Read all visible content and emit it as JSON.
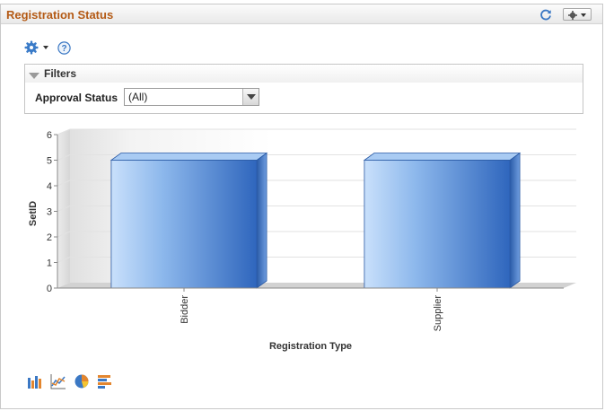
{
  "pagelet": {
    "title": "Registration Status"
  },
  "filters": {
    "title": "Filters",
    "approval_status_label": "Approval Status",
    "approval_status_value": "(All)"
  },
  "chart_data": {
    "type": "bar",
    "categories": [
      "Bidder",
      "Supplier"
    ],
    "values": [
      5,
      5
    ],
    "xlabel": "Registration Type",
    "ylabel": "SetID",
    "ylim": [
      0,
      6
    ],
    "yticks": [
      "0",
      "1",
      "2",
      "3",
      "4",
      "5",
      "6"
    ],
    "grid": true,
    "legend": "none",
    "bar_color": "#4a7fc9"
  },
  "icons": {
    "refresh": "refresh-icon",
    "pagelet_actions": "gear-dropdown-icon",
    "options": "gear-icon",
    "help": "help-icon",
    "filters_toggle": "triangle-down-icon",
    "chart_types": [
      "bar-chart-icon",
      "line-chart-icon",
      "pie-chart-icon",
      "horizontal-bar-chart-icon"
    ]
  },
  "colors": {
    "title": "#b45a15",
    "accent": "#2f6fc1"
  }
}
